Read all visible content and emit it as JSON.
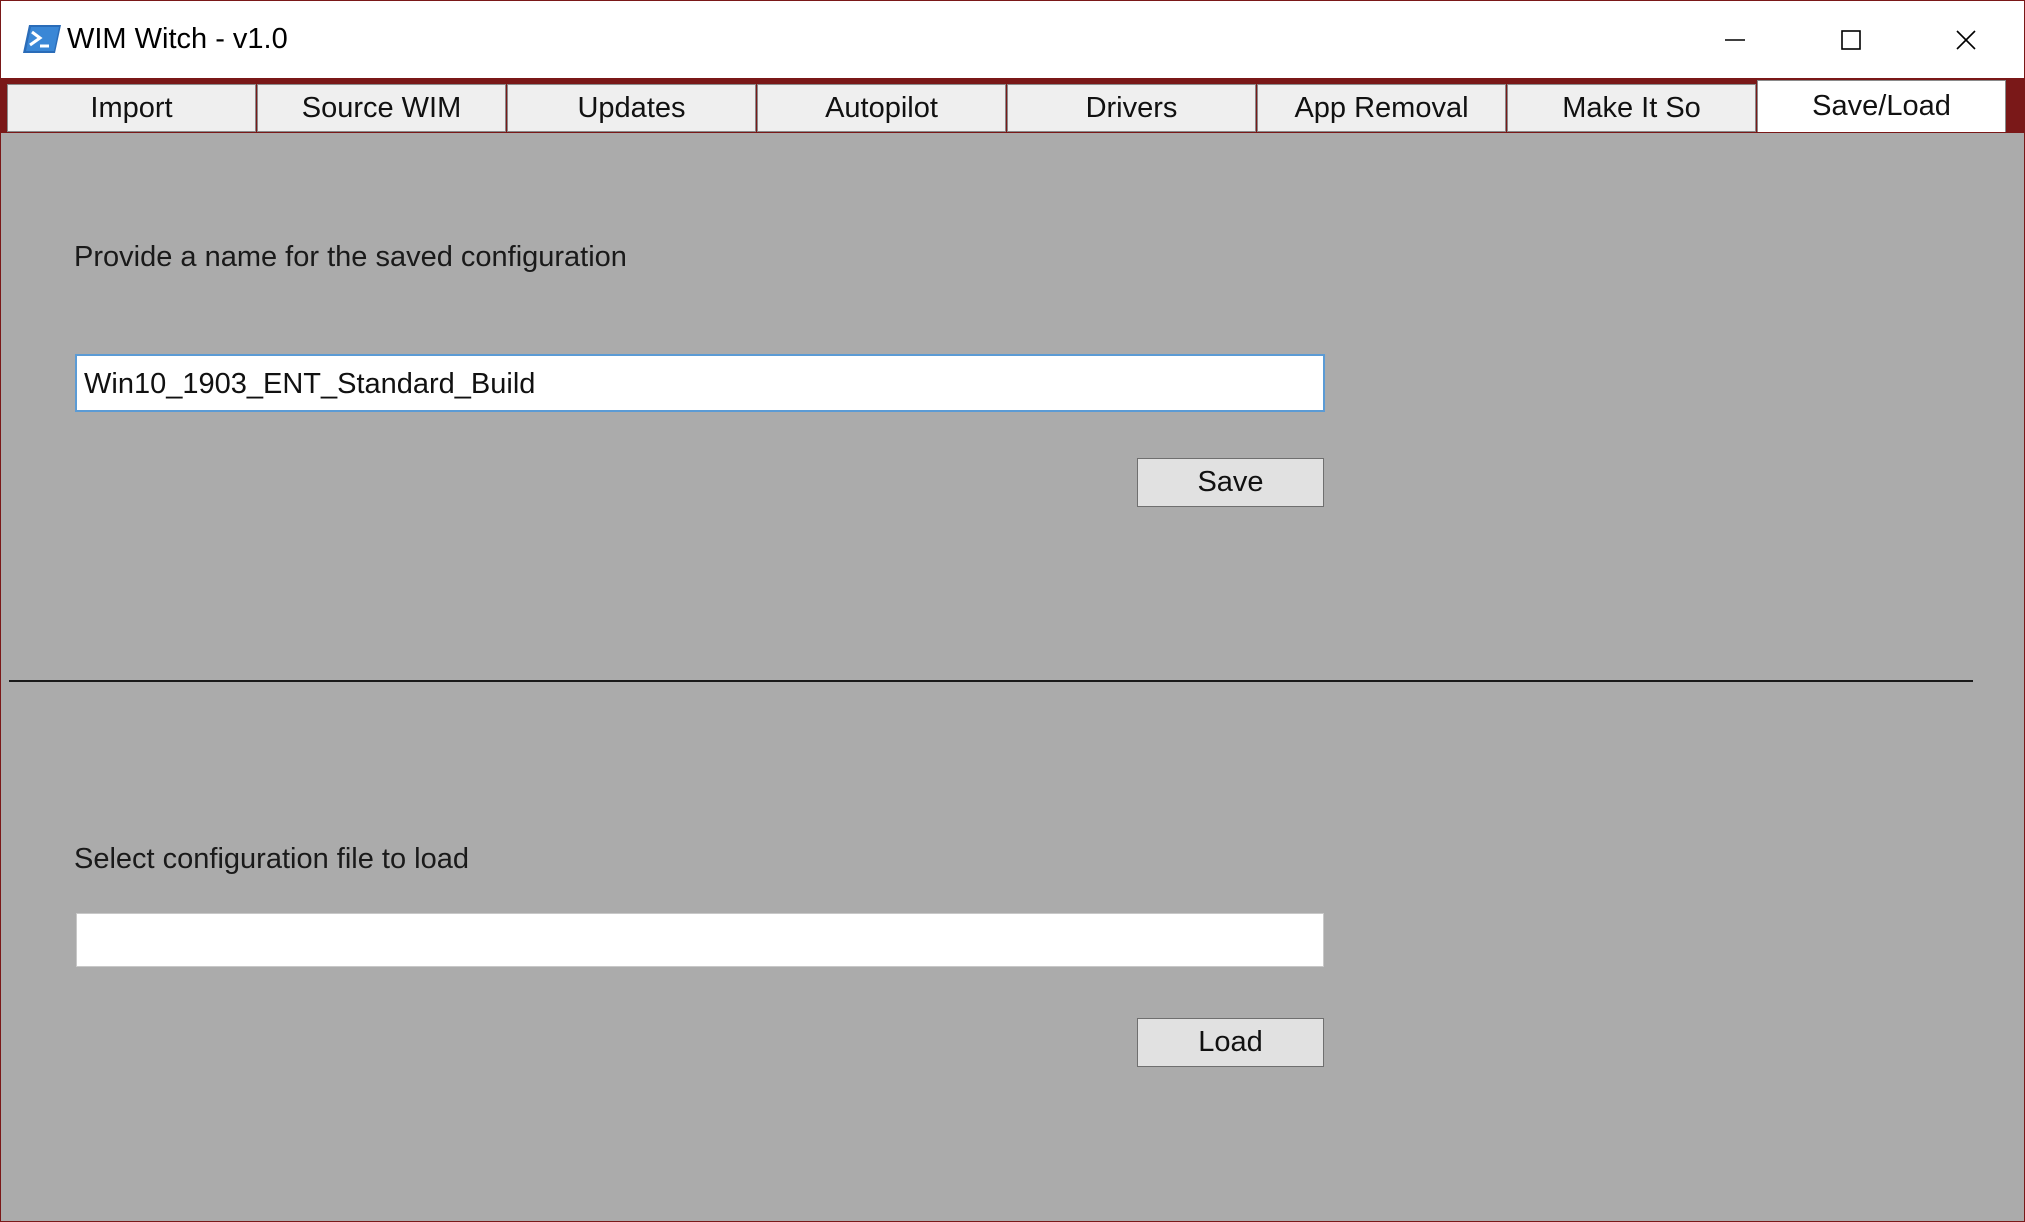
{
  "window": {
    "title": "WIM Witch - v1.0",
    "icon": "powershell-icon",
    "accent_color": "#7a1818",
    "background_color": "#ababab"
  },
  "tabs": [
    {
      "label": "Import"
    },
    {
      "label": "Source WIM"
    },
    {
      "label": "Updates"
    },
    {
      "label": "Autopilot"
    },
    {
      "label": "Drivers"
    },
    {
      "label": "App Removal"
    },
    {
      "label": "Make It So"
    },
    {
      "label": "Save/Load",
      "active": true
    }
  ],
  "save_section": {
    "label": "Provide a name for the saved configuration",
    "input_value": "Win10_1903_ENT_Standard_Build",
    "button_label": "Save"
  },
  "load_section": {
    "label": "Select configuration file to load",
    "input_value": "",
    "button_label": "Load"
  }
}
